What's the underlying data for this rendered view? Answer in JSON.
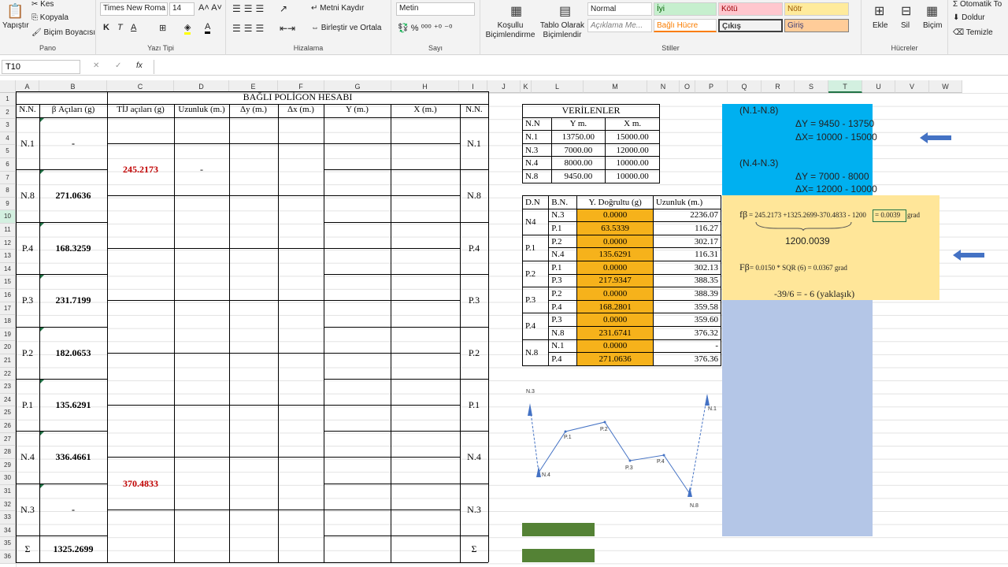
{
  "ribbon": {
    "clipboard": {
      "paste": "Yapıştır",
      "cut": "Kes",
      "copy": "Kopyala",
      "format_painter": "Biçim Boyacısı",
      "group": "Pano"
    },
    "font": {
      "name": "Times New Roma",
      "size": "14",
      "group": "Yazı Tipi"
    },
    "alignment": {
      "wrap": "Metni Kaydır",
      "merge": "Birleştir ve Ortala",
      "group": "Hizalama"
    },
    "number": {
      "format": "Metin",
      "group": "Sayı"
    },
    "styles": {
      "conditional": "Koşullu Biçimlendirme",
      "table": "Tablo Olarak Biçimlendir",
      "normal": "Normal",
      "iyi": "İyi",
      "kotu": "Kötü",
      "notr": "Nötr",
      "aciklama": "Açıklama Me...",
      "bagli": "Bağlı Hücre",
      "cikis": "Çıkış",
      "giris": "Giriş",
      "group": "Stiller"
    },
    "cells": {
      "insert": "Ekle",
      "delete": "Sil",
      "format": "Biçim",
      "group": "Hücreler"
    },
    "editing": {
      "autosum": "Otomatik To",
      "fill": "Doldur",
      "clear": "Temizle"
    }
  },
  "formula_bar": {
    "name_box": "T10",
    "fx": "fx",
    "x": "✕",
    "check": "✓"
  },
  "columns": [
    "A",
    "B",
    "C",
    "D",
    "E",
    "F",
    "G",
    "H",
    "I",
    "J",
    "K",
    "L",
    "M",
    "N",
    "O",
    "P",
    "Q",
    "R",
    "S",
    "T",
    "U",
    "V",
    "W"
  ],
  "rows": [
    "1",
    "2",
    "3",
    "4",
    "5",
    "6",
    "7",
    "8",
    "9",
    "10",
    "11",
    "12",
    "13",
    "14",
    "15",
    "16",
    "17",
    "18",
    "19",
    "20",
    "21",
    "22",
    "23",
    "24",
    "25",
    "26",
    "27",
    "28",
    "29",
    "30",
    "31",
    "32",
    "33",
    "34",
    "35",
    "36"
  ],
  "main": {
    "title": "BAĞLI POLİGON HESABI",
    "headers": [
      "N.N.",
      "β Açıları (g)",
      "TİJ açıları (g)",
      "Uzunluk (m.)",
      "Δy (m.)",
      "Δx  (m.)",
      "Y   (m.)",
      "X   (m.)",
      "N.N."
    ],
    "stations": [
      {
        "nn": "N.1",
        "beta": "-"
      },
      {
        "nn": "N.8",
        "beta": "271.0636"
      },
      {
        "nn": "P.4",
        "beta": "168.3259"
      },
      {
        "nn": "P.3",
        "beta": "231.7199"
      },
      {
        "nn": "P.2",
        "beta": "182.0653"
      },
      {
        "nn": "P.1",
        "beta": "135.6291"
      },
      {
        "nn": "N.4",
        "beta": "336.4661"
      },
      {
        "nn": "N.3",
        "beta": "-"
      }
    ],
    "tij_top": "245.2173",
    "tij_bottom": "370.4833",
    "uzunluk_dash": "-",
    "sigma": "Σ",
    "sigma_beta": "1325.2699"
  },
  "verilenler": {
    "title": "VERİLENLER",
    "headers": [
      "N.N",
      "Y     m.",
      "X     m."
    ],
    "rows": [
      [
        "N.1",
        "13750.00",
        "15000.00"
      ],
      [
        "N.3",
        "7000.00",
        "12000.00"
      ],
      [
        "N.4",
        "8000.00",
        "10000.00"
      ],
      [
        "N.8",
        "9450.00",
        "10000.00"
      ]
    ]
  },
  "measure": {
    "headers": [
      "D.N",
      "B.N.",
      "Y. Doğrultu (g)",
      "Uzunluk (m.)"
    ],
    "groups": [
      {
        "dn": "N4",
        "rows": [
          [
            "N.3",
            "0.0000",
            "2236.07"
          ],
          [
            "P.1",
            "63.5339",
            "116.27"
          ]
        ]
      },
      {
        "dn": "P.1",
        "rows": [
          [
            "P.2",
            "0.0000",
            "302.17"
          ],
          [
            "N.4",
            "135.6291",
            "116.31"
          ]
        ]
      },
      {
        "dn": "P.2",
        "rows": [
          [
            "P.1",
            "0.0000",
            "302.13"
          ],
          [
            "P.3",
            "217.9347",
            "388.35"
          ]
        ]
      },
      {
        "dn": "P.3",
        "rows": [
          [
            "P.2",
            "0.0000",
            "388.39"
          ],
          [
            "P.4",
            "168.2801",
            "359.58"
          ]
        ]
      },
      {
        "dn": "P.4",
        "rows": [
          [
            "P.3",
            "0.0000",
            "359.60"
          ],
          [
            "N.8",
            "231.6741",
            "376.32"
          ]
        ]
      },
      {
        "dn": "N.8",
        "rows": [
          [
            "N.1",
            "0.0000",
            "-"
          ],
          [
            "P.4",
            "271.0636",
            "376.36"
          ]
        ]
      }
    ]
  },
  "notes": {
    "n1n8": "(N.1-N.8)",
    "dy1": "ΔY = 9450 - 13750",
    "dx1": "ΔX= 10000 - 15000",
    "n4n3": "(N.4-N.3)",
    "dy2": "ΔY = 7000 - 8000",
    "dx2": "ΔX= 12000 - 10000",
    "fb_sym": "fβ",
    "fb_formula": "= 245.2173 +1325.2699-370.4833 - 1200",
    "fb_result": "= 0.0039",
    "fb_unit": "grad",
    "sum": "1200.0039",
    "Fb_sym": "Fβ",
    "Fb_formula": "= 0.0150 * SQR (6) = 0.0367 grad",
    "approx": "-39/6 = - 6 (yaklaşık)"
  },
  "sketch_labels": [
    "N.3",
    "N.4",
    "P.1",
    "P.2",
    "P.3",
    "P.4",
    "N.8",
    "N.1"
  ],
  "colors": {
    "cyan": "#00b0f0",
    "yellow": "#ffe699",
    "lavender": "#b4c6e7",
    "orange": "#f6b21b",
    "green": "#548235",
    "red": "#c00000",
    "arrow": "#4472c4"
  }
}
